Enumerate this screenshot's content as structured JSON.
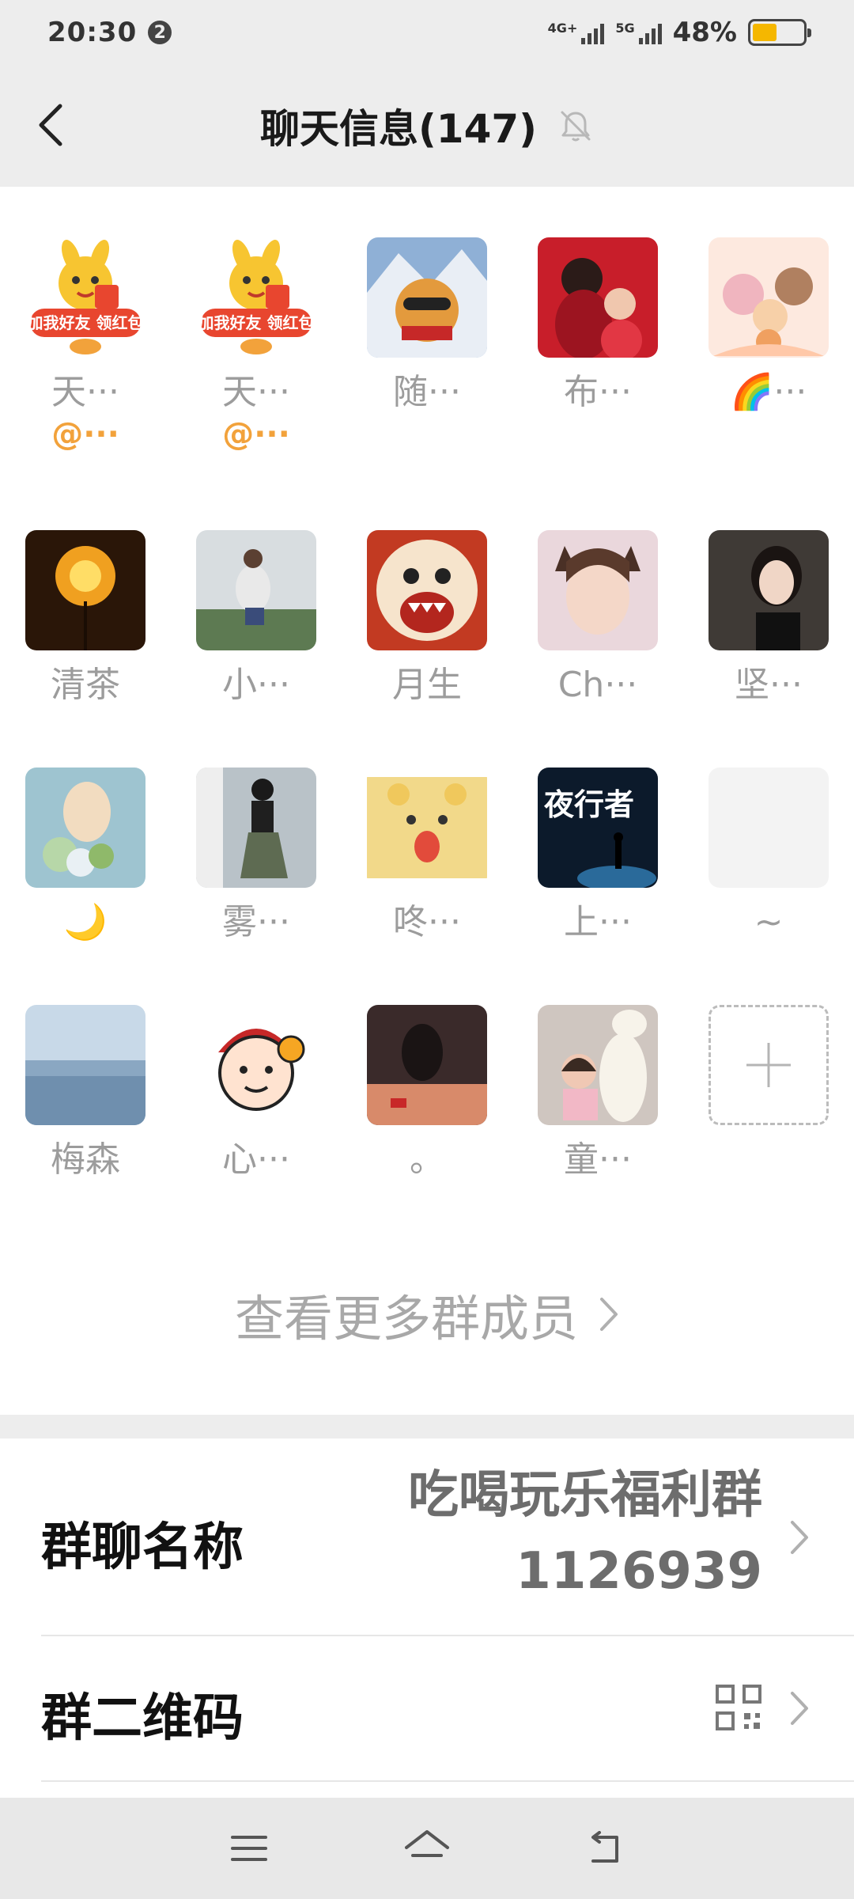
{
  "status_bar": {
    "time": "20:30",
    "notification_count": "2",
    "signal_1_label": "4G+",
    "signal_2_label": "5G",
    "battery_percent": "48%",
    "battery_level": 0.48,
    "battery_color": "#f5b700"
  },
  "header": {
    "title": "聊天信息(147)",
    "back_icon": "chevron-left-icon",
    "mute_icon": "bell-muted-icon"
  },
  "members": [
    {
      "name": "天···",
      "tag": "@···"
    },
    {
      "name": "天···",
      "tag": "@···"
    },
    {
      "name": "随···"
    },
    {
      "name": "布···"
    },
    {
      "name": "🌈···"
    },
    {
      "name": "清茶"
    },
    {
      "name": "小···"
    },
    {
      "name": "月生"
    },
    {
      "name": "Ch···"
    },
    {
      "name": "坚···"
    },
    {
      "name": "🌙"
    },
    {
      "name": "雾···"
    },
    {
      "name": "咚···"
    },
    {
      "name": "上···"
    },
    {
      "name": "~"
    },
    {
      "name": "梅森"
    },
    {
      "name": "心···"
    },
    {
      "name": "。"
    },
    {
      "name": "童···"
    }
  ],
  "avatar_badge_text": {
    "line1": "加我好友",
    "line2": "领红包"
  },
  "avatar_poster_text": "夜行者",
  "add_member_icon": "plus-icon",
  "more_members_label": "查看更多群成员",
  "settings": {
    "group_name": {
      "label": "群聊名称",
      "value_line1": "吃喝玩乐福利群",
      "value_line2": "1126939"
    },
    "group_qr": {
      "label": "群二维码",
      "icon": "qr-code-icon"
    }
  },
  "navbar": {
    "icons": [
      "menu-icon",
      "home-icon",
      "back-icon"
    ]
  }
}
